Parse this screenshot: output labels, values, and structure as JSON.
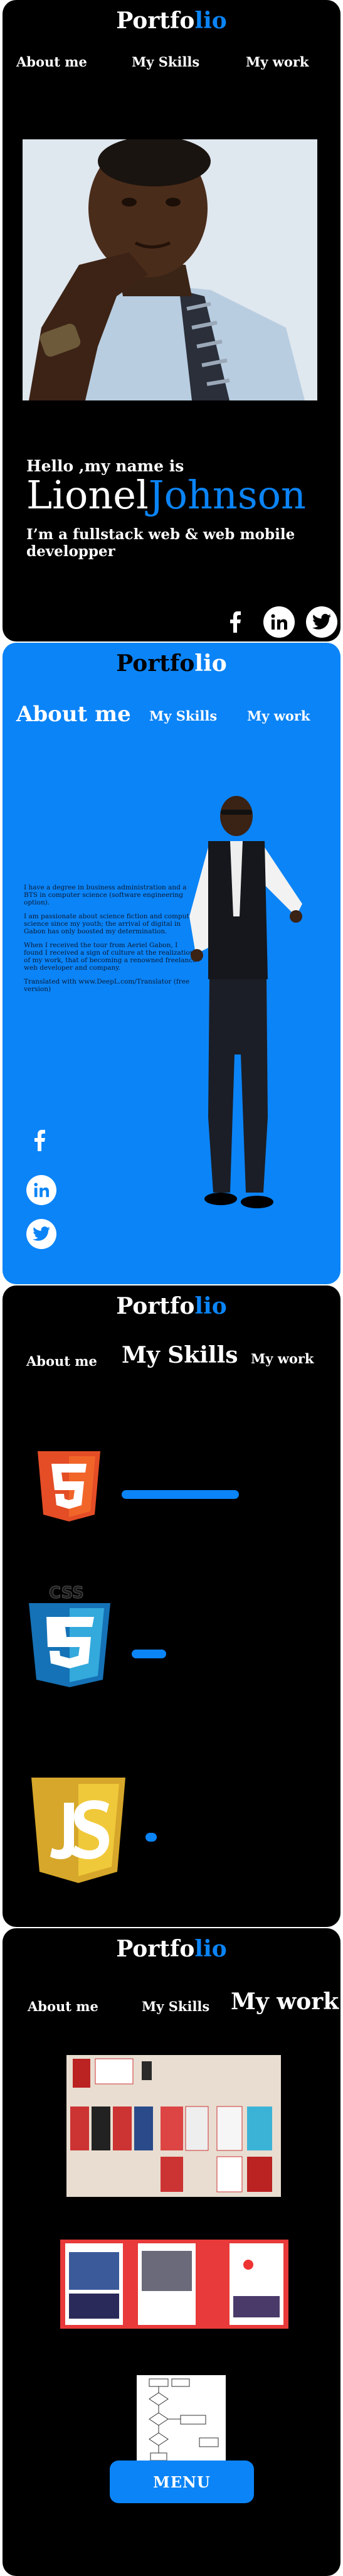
{
  "brand": {
    "logo_part1": "Portfo",
    "logo_part2": "lio"
  },
  "nav": {
    "about": "About me",
    "skills": "My Skills",
    "work": "My work"
  },
  "hero": {
    "greeting": "Hello ,my name is",
    "first_name": "Lionel",
    "last_name": "Johnson",
    "tagline": "I’m a fullstack web & web mobile developper"
  },
  "about": {
    "title": "About me",
    "paragraphs": [
      "I have a degree in business administration and a BTS in computer science (software engineering option).",
      "I am passionate about science fiction and computer science since my youth; the arrival of digital in Gabon has only boosted my determination.",
      "When I received the tour from Aeriel Gabon, I found I received a sign of culture at the realization of my work, that of becoming a renowned freelance web developer and company.",
      "Translated with www.DeepL.com/Translator (free version)"
    ]
  },
  "skills": {
    "items": [
      {
        "name": "HTML",
        "icon": "html5-icon",
        "level": 0.85
      },
      {
        "name": "CSS",
        "icon": "css3-icon",
        "level": 0.25
      },
      {
        "name": "JS",
        "icon": "js-icon",
        "level": 0.08
      }
    ]
  },
  "work": {
    "shots": [
      "project-mockup-grid",
      "mobile-screens",
      "flowchart-diagram"
    ]
  },
  "menu_label": "MENU",
  "colors": {
    "accent": "#0b84f7",
    "background": "#000000"
  }
}
